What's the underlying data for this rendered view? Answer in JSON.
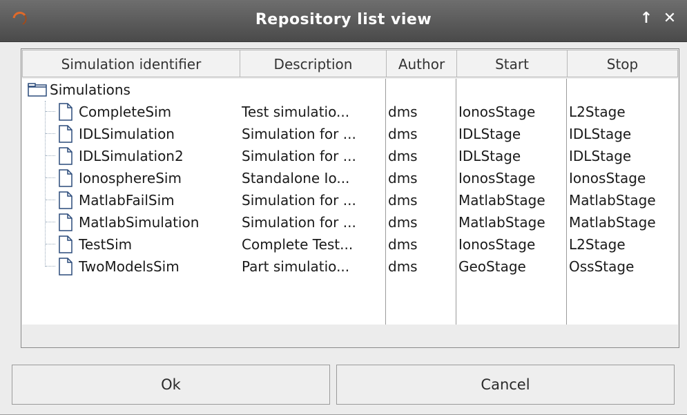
{
  "window": {
    "title": "Repository list view",
    "up_glyph": "↑",
    "close_glyph": "✕"
  },
  "table": {
    "columns": [
      "Simulation identifier",
      "Description",
      "Author",
      "Start",
      "Stop"
    ],
    "root": {
      "label": "Simulations",
      "icon": "folder-icon"
    },
    "rows": [
      {
        "id": "CompleteSim",
        "description": "Test simulatio...",
        "author": "dms",
        "start": "IonosStage",
        "stop": "L2Stage"
      },
      {
        "id": "IDLSimulation",
        "description": "Simulation for ...",
        "author": "dms",
        "start": "IDLStage",
        "stop": "IDLStage"
      },
      {
        "id": "IDLSimulation2",
        "description": "Simulation for ...",
        "author": "dms",
        "start": "IDLStage",
        "stop": "IDLStage"
      },
      {
        "id": "IonosphereSim",
        "description": "Standalone Io...",
        "author": "dms",
        "start": "IonosStage",
        "stop": "IonosStage"
      },
      {
        "id": "MatlabFailSim",
        "description": "Simulation for ...",
        "author": "dms",
        "start": "MatlabStage",
        "stop": "MatlabStage"
      },
      {
        "id": "MatlabSimulation",
        "description": "Simulation for ...",
        "author": "dms",
        "start": "MatlabStage",
        "stop": "MatlabStage"
      },
      {
        "id": "TestSim",
        "description": "Complete Test...",
        "author": "dms",
        "start": "IonosStage",
        "stop": "L2Stage"
      },
      {
        "id": "TwoModelsSim",
        "description": "Part simulatio...",
        "author": "dms",
        "start": "GeoStage",
        "stop": "OssStage"
      }
    ]
  },
  "buttons": {
    "ok": "Ok",
    "cancel": "Cancel"
  }
}
